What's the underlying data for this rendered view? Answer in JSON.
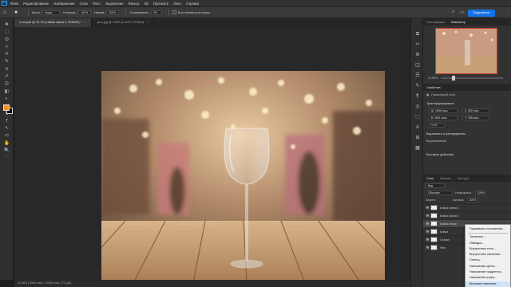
{
  "app": {
    "logo": "Ps"
  },
  "menu": [
    "Файл",
    "Редактирование",
    "Изображение",
    "Слои",
    "Текст",
    "Выделение",
    "Фильтр",
    "3D",
    "Просмотр",
    "Окно",
    "Справка"
  ],
  "options": {
    "mode_label": "Кисть:",
    "mode_value": "Норм.",
    "opacity_label": "Непрозр.:",
    "opacity_value": "100%",
    "flow_label": "Нажим:",
    "flow_value": "100%",
    "smooth_label": "Сглаживание:",
    "smooth_value": "0%",
    "extra_label": "Восстановить историю",
    "share_label": "Поделиться"
  },
  "tabs": [
    {
      "label": "стол.psd @ 12,1% (Новая папка 2, RGB/8*) *",
      "active": true,
      "close": "×"
    },
    {
      "label": "фон.jpg @ 133% (Слой 0, RGB/8)",
      "active": false,
      "close": "×"
    }
  ],
  "tools": [
    "✥",
    "⬚",
    "ʘ",
    "⊹",
    "⌗",
    "✎",
    "⦸",
    "✐",
    "⊡",
    "◧",
    "◐",
    "◔",
    "⬯",
    "T",
    "↖",
    "▭",
    "✋",
    "🔍",
    "⋯"
  ],
  "statusbar": "12,06% | 3000 пикс. x 2000 пикс. (72 ppi)",
  "right_strip_icons": [
    "⧉",
    "✂",
    "⚙",
    "◫",
    "☰",
    "✎",
    "¶",
    "◎",
    "⬚",
    "A",
    "⊞",
    "▦"
  ],
  "navigator": {
    "tabs": [
      "Гистограмма",
      "Навигатор"
    ],
    "active": 1,
    "zoom": "12,06%"
  },
  "properties": {
    "tabs": [
      "Свойства"
    ],
    "kind": "Пиксельный слой",
    "section_transform": "Трансформировать",
    "w": "Ш: 1894 пикс.",
    "x": "X: 580 пикс.",
    "h": "В: 2651 пикс.",
    "y": "Y: 338 пикс.",
    "angle": "0,00°",
    "section_align": "Выровнять и распределить",
    "align_label": "Выравнивание:",
    "section_quick": "Быстрые действия"
  },
  "layers": {
    "tabs": [
      "Слои",
      "Каналы",
      "Контуры"
    ],
    "kind_label": "Вид",
    "blend": "Обычные",
    "opacity_label": "Непрозрачн.:",
    "opacity": "100%",
    "lock_label": "Закреп.:",
    "fill_label": "Заливка:",
    "fill": "100%",
    "rows": [
      {
        "name": "Блики копия 3",
        "selected": false
      },
      {
        "name": "Блики копия 2",
        "selected": false
      },
      {
        "name": "Блики копия",
        "selected": true
      },
      {
        "name": "Блики",
        "selected": false
      },
      {
        "name": "Стакан",
        "selected": false
      },
      {
        "name": "Фон",
        "selected": false
      }
    ]
  },
  "context_menu": {
    "items": [
      "Параметры наложения...",
      "Тиснение...",
      "Обводка...",
      "Внутренняя тень...",
      "Внутреннее свечение...",
      "Глянец...",
      "Наложение цвета...",
      "Наложение градиента...",
      "Наложение узора...",
      "Внешнее свечение..."
    ],
    "highlighted": 9
  },
  "colors": {
    "foreground": "#f7931e",
    "background": "#000000",
    "accent": "#1473e6"
  }
}
